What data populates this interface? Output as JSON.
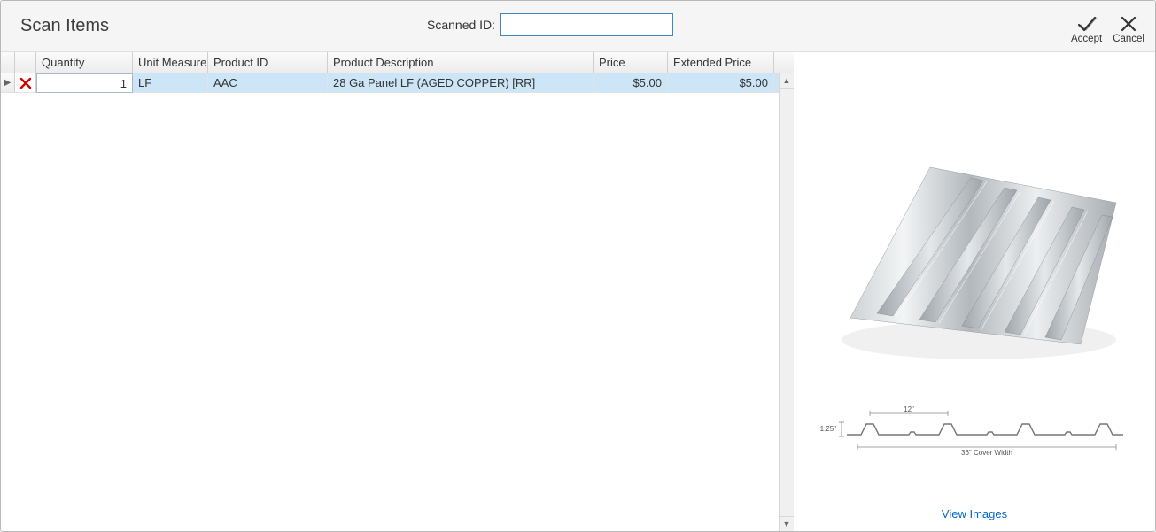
{
  "header": {
    "title": "Scan Items",
    "scanned_label": "Scanned ID:",
    "scanned_value": "",
    "accept_label": "Accept",
    "cancel_label": "Cancel"
  },
  "grid": {
    "columns": {
      "quantity": "Quantity",
      "unit_measure": "Unit Measure",
      "product_id": "Product ID",
      "product_description": "Product Description",
      "price": "Price",
      "extended_price": "Extended Price"
    },
    "rows": [
      {
        "quantity": "1",
        "unit_measure": "LF",
        "product_id": "AAC",
        "product_description": "28 Ga Panel LF (AGED COPPER) [RR]",
        "price": "$5.00",
        "extended_price": "$5.00",
        "selected": true
      }
    ]
  },
  "preview": {
    "dim_rib_spacing": "12\"",
    "dim_rib_height": "1.25\"",
    "dim_cover_width": "36\" Cover Width",
    "view_images_label": "View Images"
  }
}
